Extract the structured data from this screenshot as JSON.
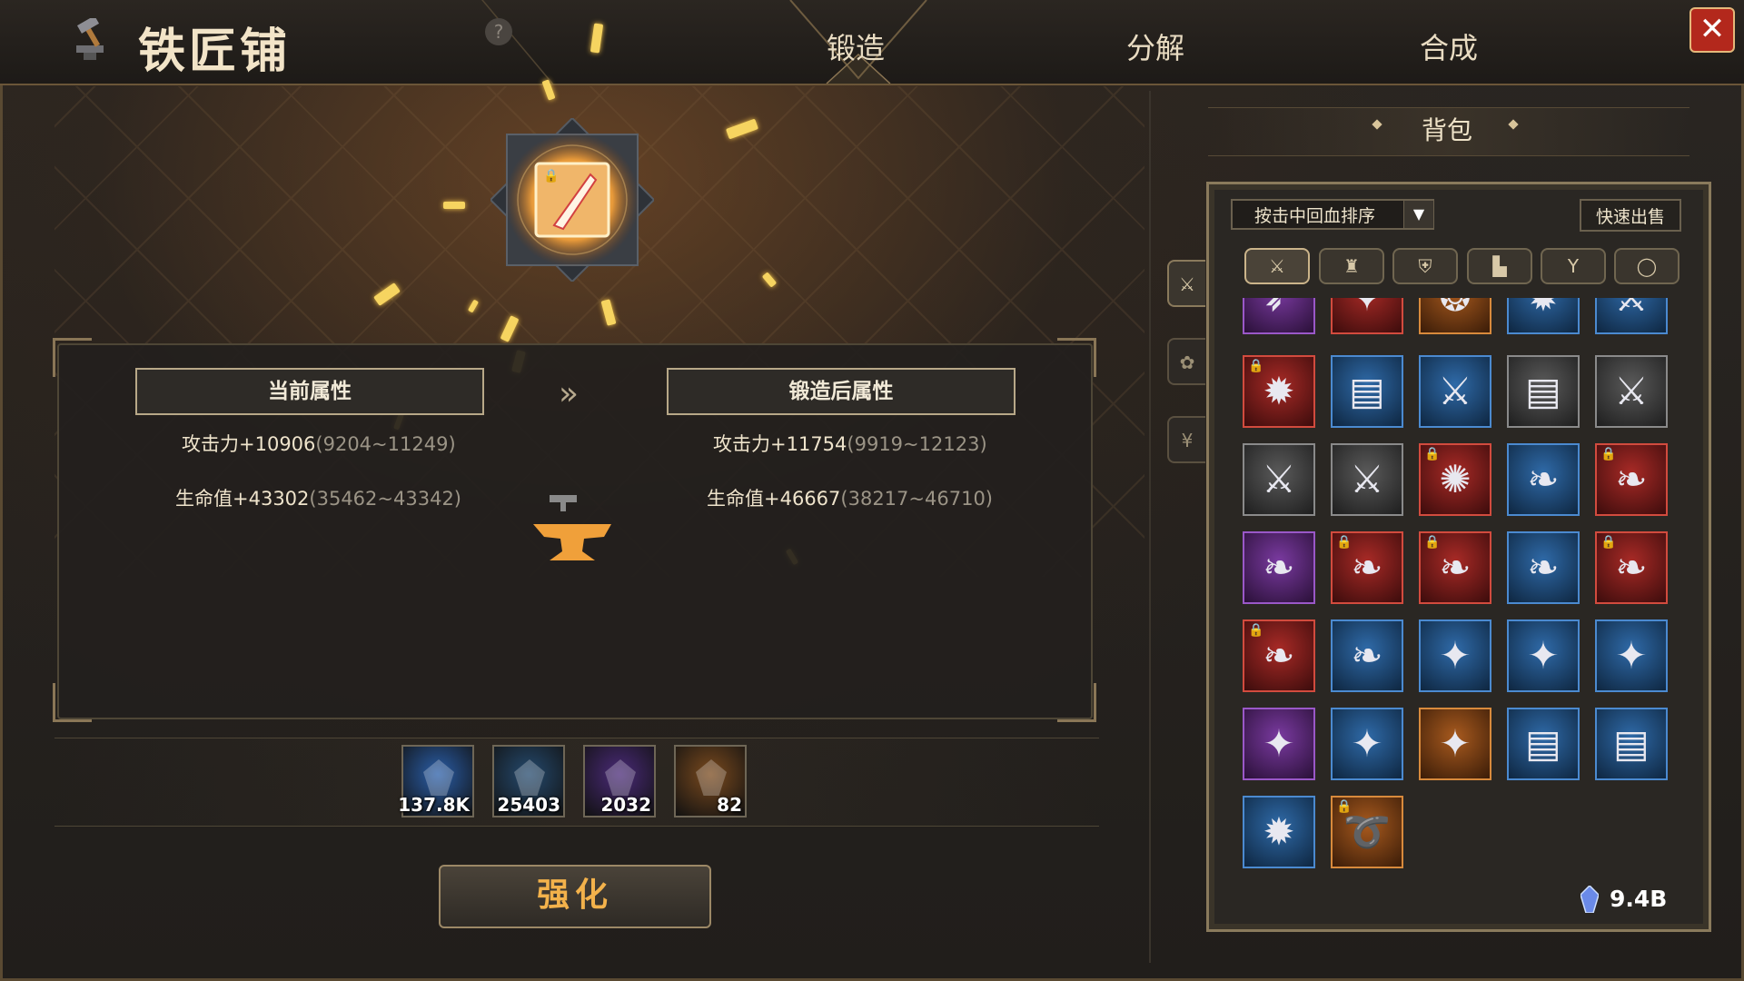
{
  "header": {
    "title": "铁匠铺",
    "help_label": "?",
    "close_label": "✕",
    "tabs": [
      {
        "label": "锻造",
        "active": true
      },
      {
        "label": "分解",
        "active": false
      },
      {
        "label": "合成",
        "active": false
      }
    ]
  },
  "attributes": {
    "current_header": "当前属性",
    "after_header": "锻造后属性",
    "current": [
      {
        "label": "攻击力+10906",
        "range": "(9204~11249)"
      },
      {
        "label": "生命值+43302",
        "range": "(35462~43342)"
      }
    ],
    "after": [
      {
        "label": "攻击力+11754",
        "range": "(9919~12123)"
      },
      {
        "label": "生命值+46667",
        "range": "(38217~46710)"
      }
    ],
    "arrow": "»"
  },
  "materials": [
    {
      "qty": "137.8K",
      "color": "#2a5ea8",
      "icon": "blue-crystal-icon"
    },
    {
      "qty": "25403",
      "color": "#254a6e",
      "icon": "ore-pile-icon"
    },
    {
      "qty": "2032",
      "color": "#4a2a78",
      "icon": "purple-ore-icon"
    },
    {
      "qty": "82",
      "color": "#7a4a1e",
      "icon": "gold-ore-icon"
    }
  ],
  "enhance_button": "强化",
  "bag": {
    "title": "背包",
    "sort_label": "按击中回血排序",
    "quick_sell": "快速出售",
    "currency": "9.4B",
    "filters": [
      {
        "icon": "sword-icon",
        "glyph": "⚔",
        "active": true
      },
      {
        "icon": "helmet-icon",
        "glyph": "♜",
        "active": false
      },
      {
        "icon": "armor-icon",
        "glyph": "⛨",
        "active": false
      },
      {
        "icon": "boots-icon",
        "glyph": "▙",
        "active": false
      },
      {
        "icon": "necklace-icon",
        "glyph": "Y",
        "active": false
      },
      {
        "icon": "ring-icon",
        "glyph": "◯",
        "active": false
      }
    ],
    "side_tabs": [
      {
        "icon": "equipment-icon",
        "glyph": "⚔",
        "active": true
      },
      {
        "icon": "materials-icon",
        "glyph": "✿",
        "active": false
      },
      {
        "icon": "emblem-icon",
        "glyph": "¥",
        "active": false
      }
    ],
    "items": [
      {
        "q": "purple",
        "g": "➶",
        "lock": false
      },
      {
        "q": "red",
        "g": "✦",
        "lock": false
      },
      {
        "q": "orange",
        "g": "❂",
        "lock": false
      },
      {
        "q": "blue",
        "g": "✹",
        "lock": false
      },
      {
        "q": "blue",
        "g": "⚔",
        "lock": false
      },
      {
        "q": "red",
        "g": "✹",
        "lock": true
      },
      {
        "q": "blue",
        "g": "▤",
        "lock": false
      },
      {
        "q": "blue",
        "g": "⚔",
        "lock": false
      },
      {
        "q": "gray",
        "g": "▤",
        "lock": false
      },
      {
        "q": "gray",
        "g": "⚔",
        "lock": false
      },
      {
        "q": "gray",
        "g": "⚔",
        "lock": false
      },
      {
        "q": "gray",
        "g": "⚔",
        "lock": false
      },
      {
        "q": "red",
        "g": "✺",
        "lock": true
      },
      {
        "q": "blue",
        "g": "❧",
        "lock": false
      },
      {
        "q": "red",
        "g": "❧",
        "lock": true
      },
      {
        "q": "purple",
        "g": "❧",
        "lock": false
      },
      {
        "q": "red",
        "g": "❧",
        "lock": true
      },
      {
        "q": "red",
        "g": "❧",
        "lock": true
      },
      {
        "q": "blue",
        "g": "❧",
        "lock": false
      },
      {
        "q": "red",
        "g": "❧",
        "lock": true
      },
      {
        "q": "red",
        "g": "❧",
        "lock": true
      },
      {
        "q": "blue",
        "g": "❧",
        "lock": false
      },
      {
        "q": "blue",
        "g": "✦",
        "lock": false
      },
      {
        "q": "blue",
        "g": "✦",
        "lock": false
      },
      {
        "q": "blue",
        "g": "✦",
        "lock": false
      },
      {
        "q": "purple",
        "g": "✦",
        "lock": false
      },
      {
        "q": "blue",
        "g": "✦",
        "lock": false
      },
      {
        "q": "orange",
        "g": "✦",
        "lock": false
      },
      {
        "q": "blue",
        "g": "▤",
        "lock": false
      },
      {
        "q": "blue",
        "g": "▤",
        "lock": false
      },
      {
        "q": "blue",
        "g": "✹",
        "lock": false
      },
      {
        "q": "orange",
        "g": "➰",
        "lock": true
      }
    ]
  }
}
